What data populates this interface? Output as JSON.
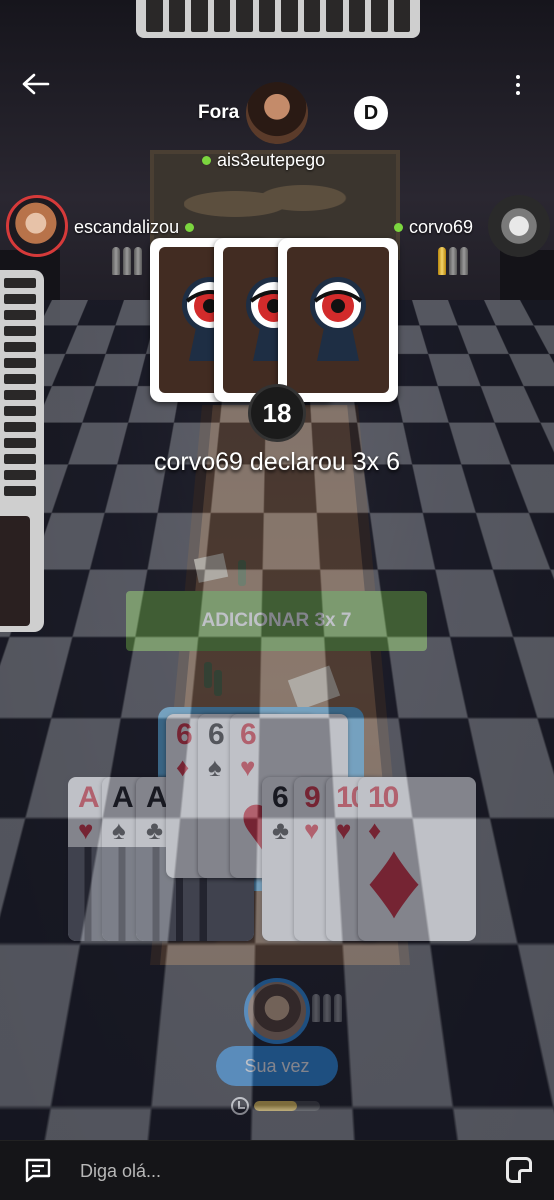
{
  "players": {
    "top": {
      "name": "ais3eutepego",
      "status_label": "Fora",
      "bullets": 0
    },
    "left": {
      "name": "escandalizou",
      "bullets_spent": 3
    },
    "right": {
      "name": "corvo69",
      "bullets_live": 1,
      "bullets_spent": 2
    },
    "me": {
      "bullets_spent": 3
    }
  },
  "dealer_badge": "D",
  "table": {
    "pile_count": "18",
    "declaration": "corvo69 declarou 3x 6",
    "action_button": "ADICIONAR 3x 7",
    "played_cards_facedown": 3
  },
  "hand": {
    "left_group": [
      {
        "rank": "A",
        "suit": "♥",
        "color": "red"
      },
      {
        "rank": "A",
        "suit": "♠",
        "color": "black"
      },
      {
        "rank": "A",
        "suit": "♣",
        "color": "black"
      }
    ],
    "selected_group": [
      {
        "rank": "6",
        "suit": "♦",
        "color": "red"
      },
      {
        "rank": "6",
        "suit": "♠",
        "color": "black"
      },
      {
        "rank": "6",
        "suit": "♥",
        "color": "red"
      }
    ],
    "right_group": [
      {
        "rank": "6",
        "suit": "♣",
        "color": "black"
      },
      {
        "rank": "9",
        "suit": "♥",
        "color": "red"
      },
      {
        "rank": "10",
        "suit": "♥",
        "color": "red"
      },
      {
        "rank": "10",
        "suit": "♦",
        "color": "red"
      }
    ]
  },
  "turn": {
    "label": "Sua vez",
    "timer_fraction": 0.65
  },
  "chat": {
    "placeholder": "Diga olá..."
  },
  "colors": {
    "accent": "#1e88e5",
    "action": "#6aa93c",
    "online": "#7cd63f",
    "timer": "#f2c94c"
  },
  "icons": [
    "back-arrow-icon",
    "more-vertical-icon",
    "dealer-icon",
    "keyhole-eye-icon",
    "clock-icon",
    "chat-icon",
    "sticker-icon",
    "bullet-icon"
  ]
}
